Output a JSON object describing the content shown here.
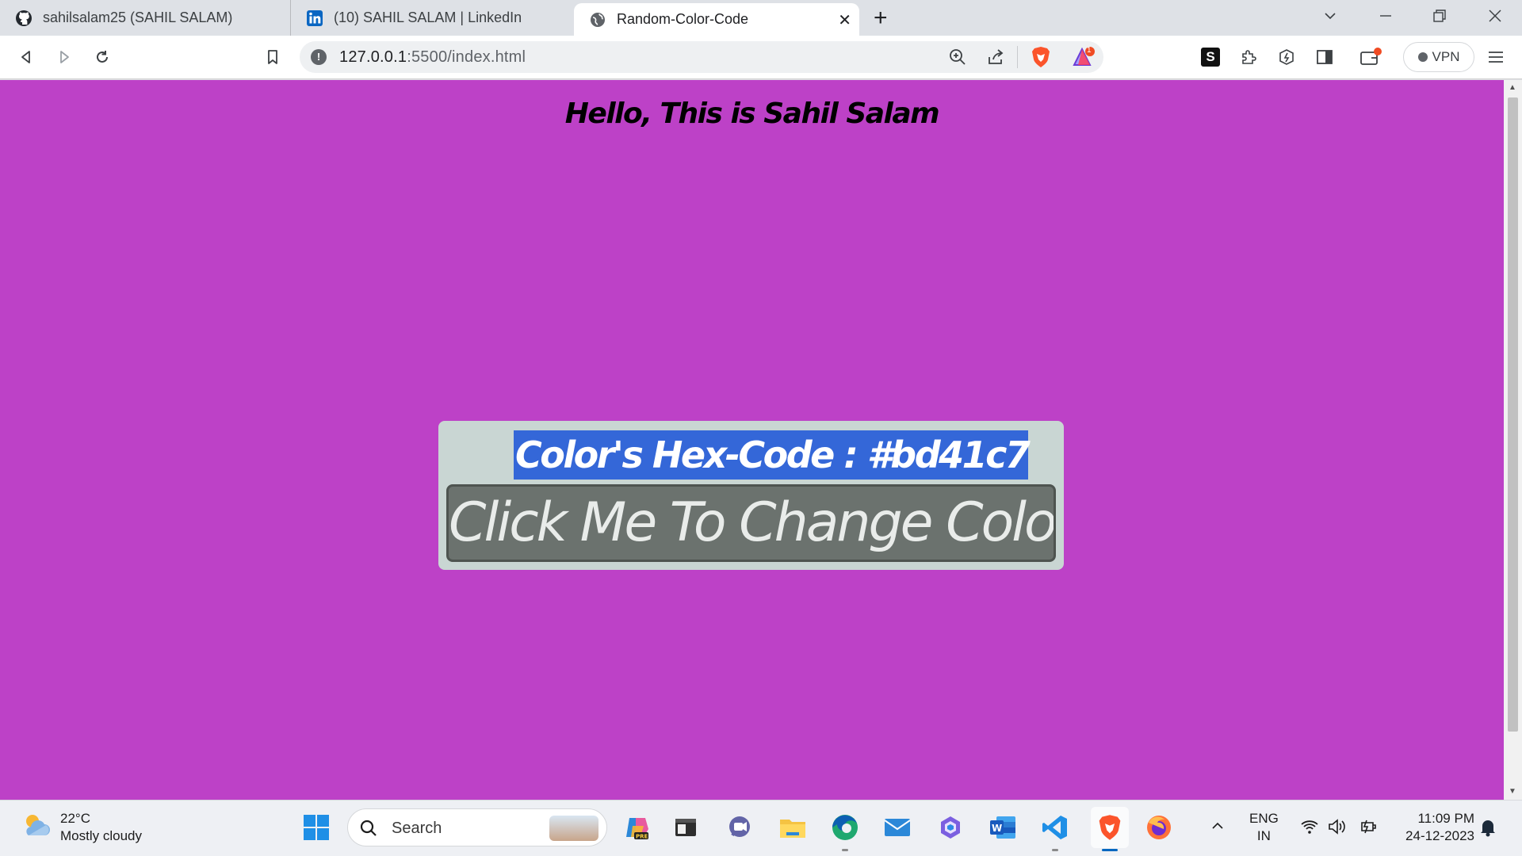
{
  "browser": {
    "tabs": [
      {
        "label": "sahilsalam25 (SAHIL SALAM)",
        "icon": "github-icon"
      },
      {
        "label": "(10) SAHIL SALAM | LinkedIn",
        "icon": "linkedin-icon"
      },
      {
        "label": "Random-Color-Code",
        "icon": "globe-icon",
        "active": true
      }
    ],
    "new_tab_glyph": "+",
    "close_glyph": "✕",
    "url_host": "127.0.0.1",
    "url_rest": ":5500/index.html",
    "vpn_label": "VPN",
    "rewards_badge": "1"
  },
  "page": {
    "background": "#bd41c7",
    "heading": "Hello, This is Sahil Salam",
    "hex_line": "Color's Hex-Code : #bd41c7",
    "button_label": "Click Me To Change Color"
  },
  "taskbar": {
    "weather_temp": "22°C",
    "weather_desc": "Mostly cloudy",
    "search_label": "Search",
    "lang_top": "ENG",
    "lang_bottom": "IN",
    "time": "11:09 PM",
    "date": "24-12-2023",
    "apps": [
      "windows-start-icon",
      "search",
      "copilot-icon",
      "terminal-icon",
      "teams-icon",
      "file-explorer-icon",
      "edge-icon",
      "mail-icon",
      "loop-icon",
      "word-icon",
      "vscode-icon",
      "brave-icon",
      "firefox-icon"
    ]
  }
}
